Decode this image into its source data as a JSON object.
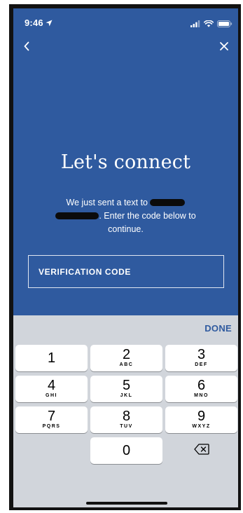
{
  "status_bar": {
    "time": "9:46",
    "icons": [
      "location-arrow-icon",
      "cellular-signal-icon",
      "wifi-icon",
      "battery-icon"
    ]
  },
  "nav": {
    "back_icon": "chevron-left-icon",
    "close_icon": "close-icon"
  },
  "page": {
    "title": "Let's connect",
    "message_part1": "We just sent a text to",
    "message_part2": ". Enter the code below to continue."
  },
  "verification": {
    "placeholder": "VERIFICATION CODE",
    "value": ""
  },
  "keyboard": {
    "done_label": "DONE",
    "keys": [
      {
        "digit": "1",
        "letters": ""
      },
      {
        "digit": "2",
        "letters": "ABC"
      },
      {
        "digit": "3",
        "letters": "DEF"
      },
      {
        "digit": "4",
        "letters": "GHI"
      },
      {
        "digit": "5",
        "letters": "JKL"
      },
      {
        "digit": "6",
        "letters": "MNO"
      },
      {
        "digit": "7",
        "letters": "PQRS"
      },
      {
        "digit": "8",
        "letters": "TUV"
      },
      {
        "digit": "9",
        "letters": "WXYZ"
      },
      {
        "digit": "0",
        "letters": ""
      }
    ],
    "delete_icon": "backspace-icon"
  },
  "colors": {
    "background": "#2f5a9f",
    "keyboard": "#d1d5db",
    "accent": "#2f5a9f"
  }
}
